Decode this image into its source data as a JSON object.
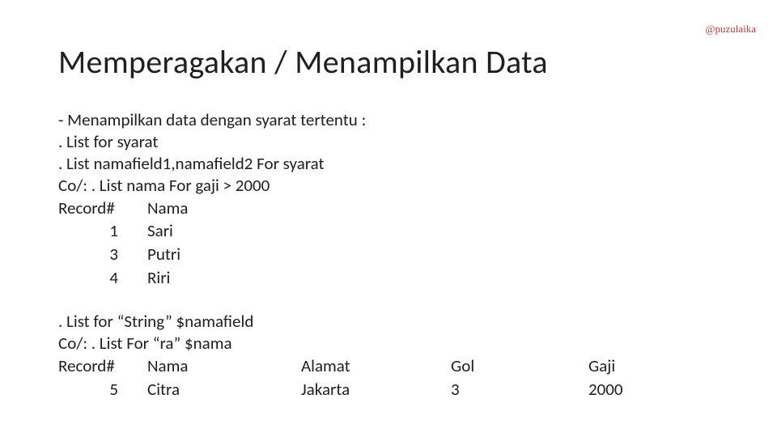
{
  "watermark": "@puzulaika",
  "title": "Memperagakan / Menampilkan Data",
  "lines1": "- Menampilkan data dengan syarat tertentu :\n. List for syarat\n. List namafield1,namafield2 For syarat\nCo/: . List nama For gaji > 2000",
  "table1": {
    "head": {
      "c1": "Record#",
      "c2": "Nama"
    },
    "rows": [
      {
        "c1": "1",
        "c2": "Sari"
      },
      {
        "c1": "3",
        "c2": "Putri"
      },
      {
        "c1": "4",
        "c2": "Riri"
      }
    ]
  },
  "lines2": ". List for “String” $namafield\nCo/: . List For “ra” $nama",
  "table2": {
    "head": {
      "c1": "Record#",
      "c2": "Nama",
      "c3": "Alamat",
      "c4": "Gol",
      "c5": "Gaji"
    },
    "rows": [
      {
        "c1": "5",
        "c2": "Citra",
        "c3": "Jakarta",
        "c4": "3",
        "c5": "2000"
      }
    ]
  }
}
